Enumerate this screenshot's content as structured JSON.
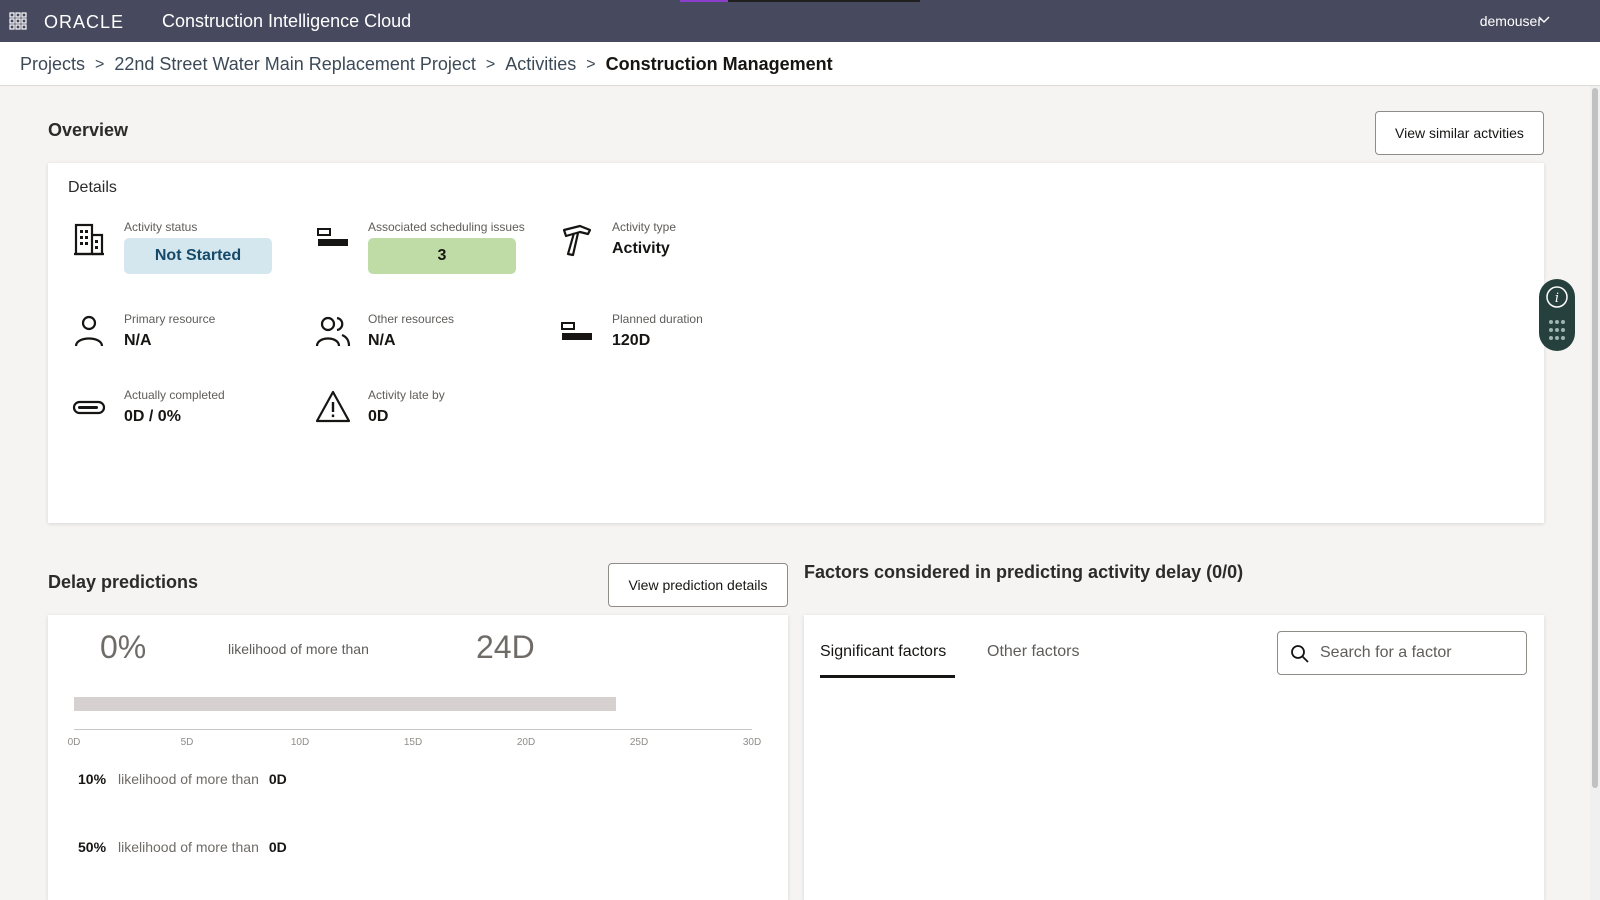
{
  "header": {
    "brand": "ORACLE",
    "product": "Construction Intelligence Cloud",
    "user": "demouser"
  },
  "breadcrumb": {
    "items": [
      "Projects",
      "22nd Street Water Main Replacement Project",
      "Activities"
    ],
    "current": "Construction Management",
    "separator": ">"
  },
  "overview": {
    "title": "Overview",
    "view_similar_label": "View similar actvities",
    "details_title": "Details",
    "metrics": {
      "activity_status": {
        "label": "Activity status",
        "value": "Not Started"
      },
      "scheduling_issues": {
        "label": "Associated scheduling issues",
        "value": "3"
      },
      "activity_type": {
        "label": "Activity type",
        "value": "Activity"
      },
      "primary_resource": {
        "label": "Primary resource",
        "value": "N/A"
      },
      "other_resources": {
        "label": "Other resources",
        "value": "N/A"
      },
      "planned_duration": {
        "label": "Planned duration",
        "value": "120D"
      },
      "actually_completed": {
        "label": "Actually completed",
        "value": "0D / 0%"
      },
      "late_by": {
        "label": "Activity late by",
        "value": "0D"
      }
    }
  },
  "delay": {
    "title": "Delay predictions",
    "view_details_label": "View prediction details",
    "headline": {
      "percent": "0%",
      "text": "likelihood of more than",
      "days": "24D"
    },
    "bar": {
      "value_days": 24,
      "max_days": 30
    },
    "axis_ticks": [
      "0D",
      "5D",
      "10D",
      "15D",
      "20D",
      "25D",
      "30D"
    ],
    "rows": [
      {
        "percent": "10%",
        "text": "likelihood of more than",
        "days": "0D"
      },
      {
        "percent": "50%",
        "text": "likelihood of more than",
        "days": "0D"
      }
    ]
  },
  "factors": {
    "title": "Factors considered in predicting activity delay (0/0)",
    "tabs": [
      "Significant factors",
      "Other factors"
    ],
    "search_placeholder": "Search for a factor"
  },
  "colors": {
    "topbar": "#474a5e",
    "status_badge_bg": "#d4e7ef",
    "status_badge_text": "#15496a",
    "issues_badge_bg": "#bfdca7",
    "side_widget": "#26403d"
  }
}
